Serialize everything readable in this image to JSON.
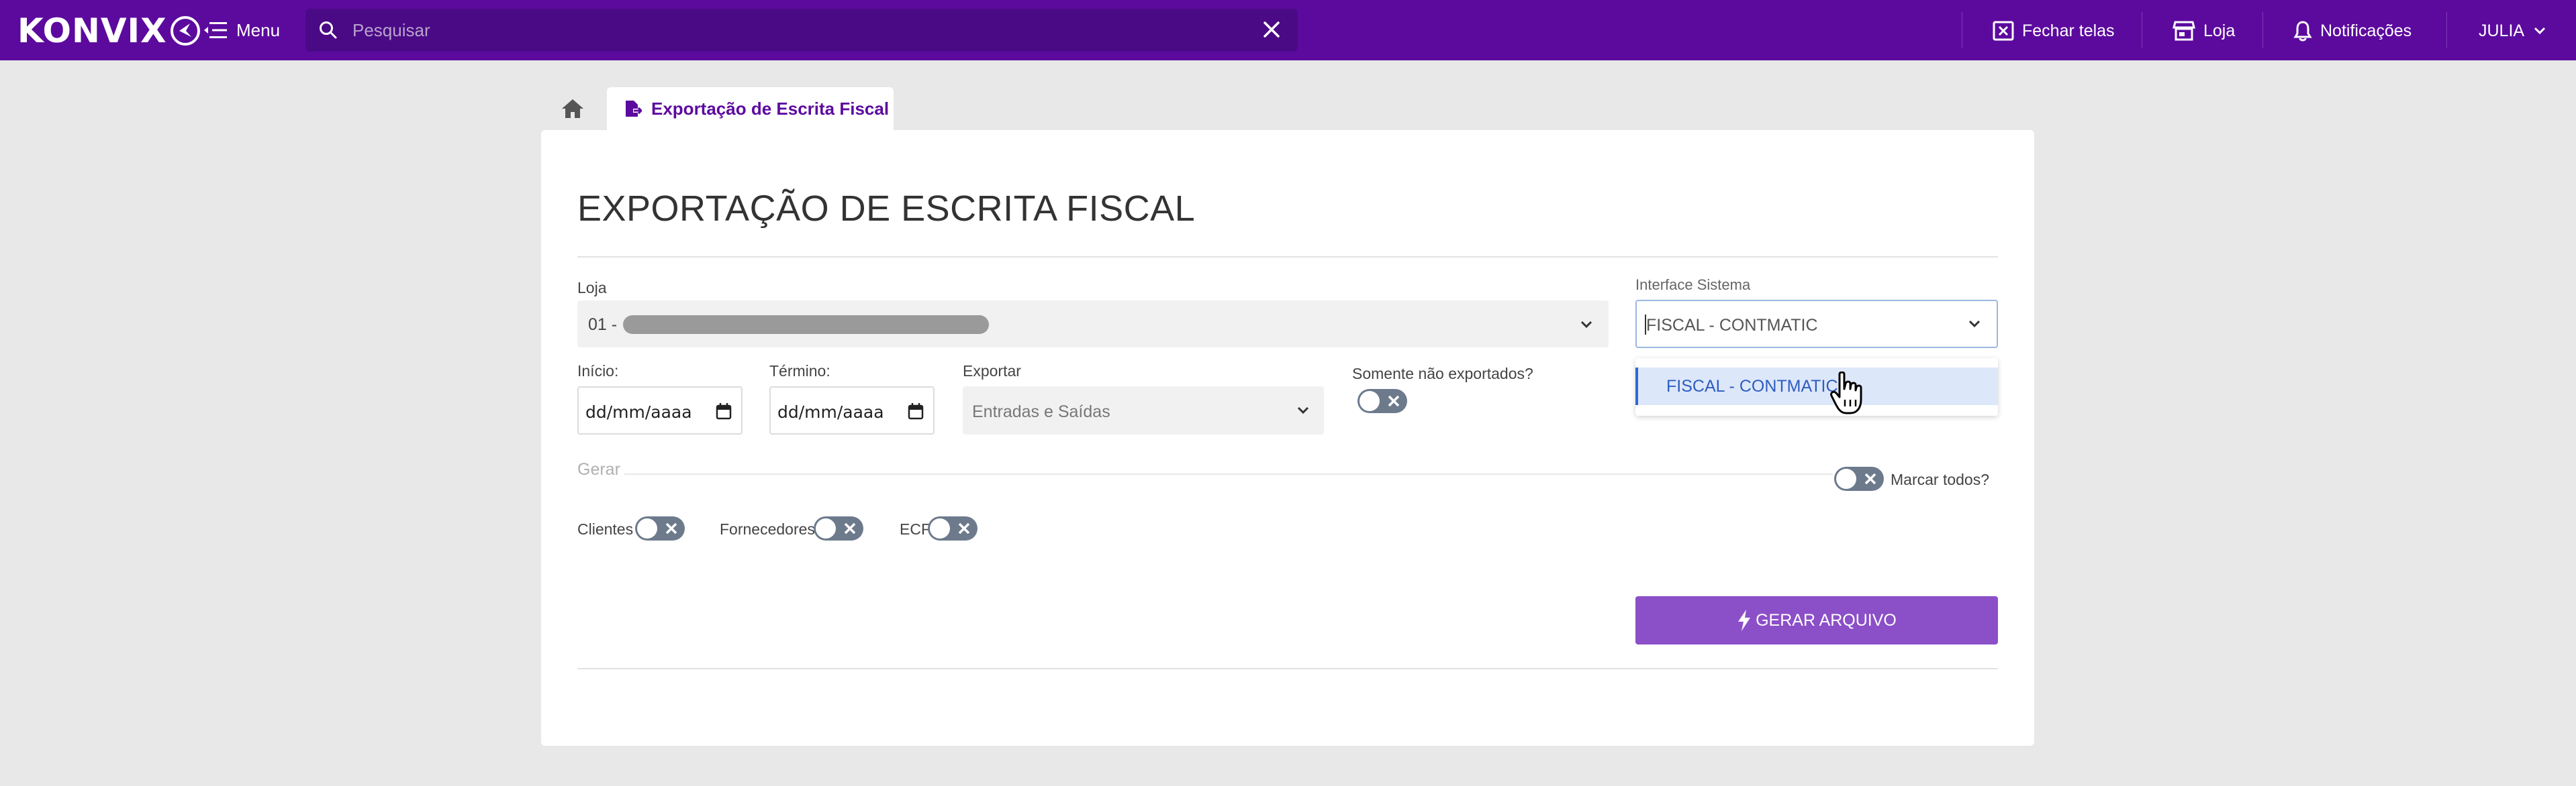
{
  "header": {
    "logo_text": "KONVIX",
    "menu_label": "Menu",
    "search_placeholder": "Pesquisar",
    "fechar_telas": "Fechar telas",
    "loja": "Loja",
    "notificacoes": "Notificações",
    "user": "JULIA"
  },
  "tabs": {
    "active": "Exportação de Escrita Fiscal"
  },
  "page": {
    "title": "EXPORTAÇÃO DE ESCRITA FISCAL"
  },
  "form": {
    "loja_label": "Loja",
    "loja_value": "01 -",
    "interface_label": "Interface Sistema",
    "interface_value": "FISCAL - CONTMATIC",
    "interface_options": [
      "FISCAL - CONTMATIC"
    ],
    "inicio_label": "Início:",
    "inicio_value": "dd/mm/aaaa",
    "termino_label": "Término:",
    "termino_value": "dd/mm/aaaa",
    "exportar_label": "Exportar",
    "exportar_value": "Entradas e Saídas",
    "somente_label": "Somente não exportados?",
    "gerar_label": "Gerar",
    "marcar_todos_label": "Marcar todos?",
    "clientes_label": "Clientes",
    "fornecedores_label": "Fornecedores",
    "ecf_label": "ECF",
    "gerar_button": "GERAR ARQUIVO"
  },
  "colors": {
    "topbar": "#5c0a9e",
    "search_bg": "#4a0a86",
    "button": "#8b4fc8",
    "toggle_off": "#6c7a8c",
    "option_highlight": "#dde7fa"
  }
}
